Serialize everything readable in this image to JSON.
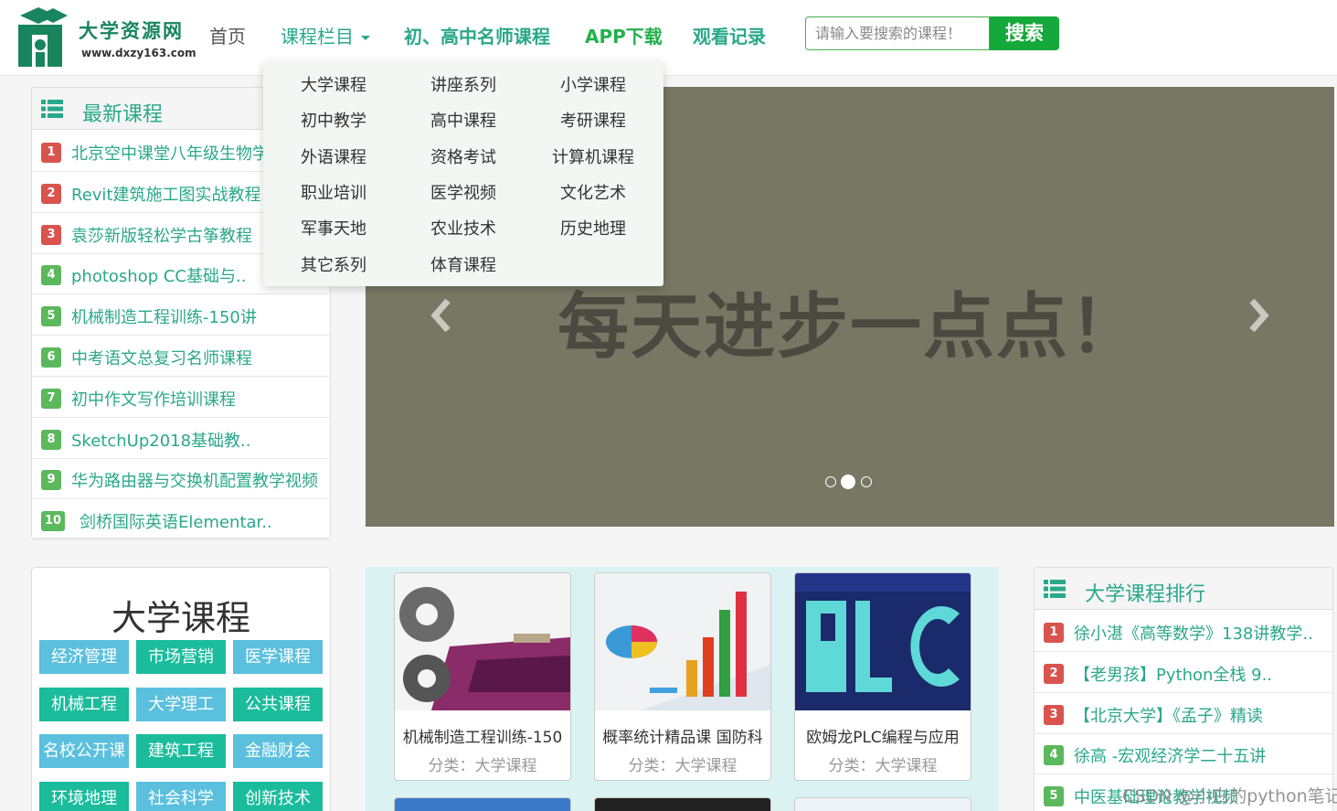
{
  "logo": {
    "name": "大学资源网",
    "url": "www.dxzy163.com"
  },
  "nav": {
    "home": "首页",
    "categories": "课程栏目",
    "teachers": "初、高中名师课程",
    "app": "APP下载",
    "history": "观看记录"
  },
  "search": {
    "placeholder": "请输入要搜索的课程！",
    "button": "搜索"
  },
  "dropdown": {
    "items": [
      "大学课程",
      "讲座系列",
      "小学课程",
      "初中教学",
      "高中课程",
      "考研课程",
      "外语课程",
      "资格考试",
      "计算机课程",
      "职业培训",
      "医学视频",
      "文化艺术",
      "军事天地",
      "农业技术",
      "历史地理",
      "其它系列",
      "体育课程"
    ]
  },
  "latest": {
    "title": "最新课程",
    "items": [
      {
        "rank": "1",
        "title": "北京空中课堂八年级生物学"
      },
      {
        "rank": "2",
        "title": "Revit建筑施工图实战教程"
      },
      {
        "rank": "3",
        "title": "袁莎新版轻松学古筝教程"
      },
      {
        "rank": "4",
        "title": "photoshop CC基础与.."
      },
      {
        "rank": "5",
        "title": "机械制造工程训练-150讲"
      },
      {
        "rank": "6",
        "title": "中考语文总复习名师课程"
      },
      {
        "rank": "7",
        "title": "初中作文写作培训课程"
      },
      {
        "rank": "8",
        "title": "SketchUp2018基础教.."
      },
      {
        "rank": "9",
        "title": "华为路由器与交换机配置教学视频"
      },
      {
        "rank": "10",
        "title": "剑桥国际英语Elementar.."
      }
    ]
  },
  "banner": {
    "slogan": "每天进步一点点！",
    "slides_total": 3,
    "active_slide": 2
  },
  "university": {
    "title": "大学课程",
    "tags": [
      "经济管理",
      "市场营销",
      "医学课程",
      "机械工程",
      "大学理工",
      "公共课程",
      "名校公开课",
      "建筑工程",
      "金融财会",
      "环境地理",
      "社会科学",
      "创新技术"
    ]
  },
  "cards": [
    {
      "title": "机械制造工程训练-150",
      "category": "分类：大学课程"
    },
    {
      "title": "概率统计精品课 国防科",
      "category": "分类：大学课程"
    },
    {
      "title": "欧姆龙PLC编程与应用",
      "category": "分类：大学课程"
    }
  ],
  "ranking": {
    "title": "大学课程排行",
    "items": [
      {
        "rank": "1",
        "title": "徐小湛《高等数学》138讲教学.."
      },
      {
        "rank": "2",
        "title": "【老男孩】Python全栈 9.."
      },
      {
        "rank": "3",
        "title": "【北京大学】《孟子》精读"
      },
      {
        "rank": "4",
        "title": "徐高 -宏观经济学二十五讲"
      },
      {
        "rank": "5",
        "title": "中医基础理论教学视频"
      }
    ]
  },
  "watermark": "CSDN @小白的python笔记",
  "colors": {
    "brand": "#2aa88a",
    "app": "#22b14c",
    "search_button": "#15a83a",
    "badge_red": "#d9534f",
    "badge_green": "#5cb85c",
    "tag_blue": "#5bc0de",
    "tag_green": "#1abc9c",
    "banner": "#777764"
  }
}
